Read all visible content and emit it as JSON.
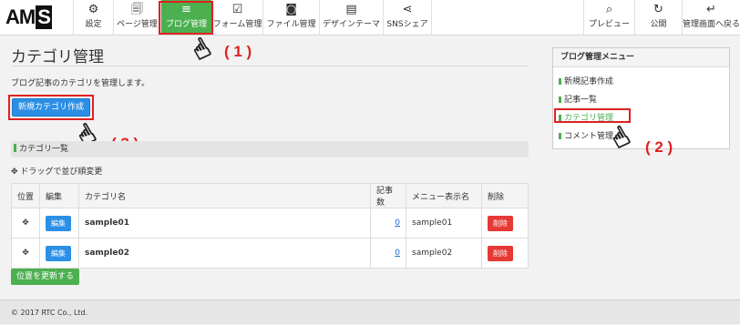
{
  "header": {
    "logo": "AMS",
    "nav": [
      {
        "label": "設定",
        "icon": "gear-icon"
      },
      {
        "label": "ページ管理",
        "icon": "pages-icon"
      },
      {
        "label": "ブログ管理",
        "icon": "blog-icon"
      },
      {
        "label": "フォーム管理",
        "icon": "form-icon"
      },
      {
        "label": "ファイル管理",
        "icon": "camera-icon"
      },
      {
        "label": "デザインテーマ",
        "icon": "design-icon"
      },
      {
        "label": "SNSシェア",
        "icon": "share-icon"
      }
    ],
    "right_nav": [
      {
        "label": "プレビュー",
        "icon": "search-icon"
      },
      {
        "label": "公開",
        "icon": "refresh-icon"
      },
      {
        "label": "管理画面へ戻る",
        "icon": "return-icon"
      }
    ],
    "active_nav": "ブログ管理"
  },
  "page": {
    "title": "カテゴリ管理",
    "description": "ブログ記事のカテゴリを管理します。",
    "new_button": "新規カテゴリ作成",
    "section_title": "カテゴリ一覧",
    "drag_hint": "ドラッグで並び順変更",
    "update_button": "位置を更新する"
  },
  "table": {
    "headers": [
      "位置",
      "編集",
      "カテゴリ名",
      "記事数",
      "メニュー表示名",
      "削除"
    ],
    "rows": [
      {
        "edit": "編集",
        "name": "sample01",
        "count": "0",
        "menu_name": "sample01",
        "delete": "削除"
      },
      {
        "edit": "編集",
        "name": "sample02",
        "count": "0",
        "menu_name": "sample02",
        "delete": "削除"
      }
    ]
  },
  "sidebar": {
    "title": "ブログ管理メニュー",
    "items": [
      "新規記事作成",
      "記事一覧",
      "カテゴリ管理",
      "コメント管理"
    ],
    "active": "カテゴリ管理"
  },
  "annotations": [
    "( 1 )",
    "( 2 )",
    "( 3 )"
  ],
  "footer": "© 2017 RTC Co., Ltd.",
  "colors": {
    "accent": "#4caf50",
    "primary": "#2b8fe6",
    "danger": "#e53935",
    "highlight": "#e02020"
  }
}
